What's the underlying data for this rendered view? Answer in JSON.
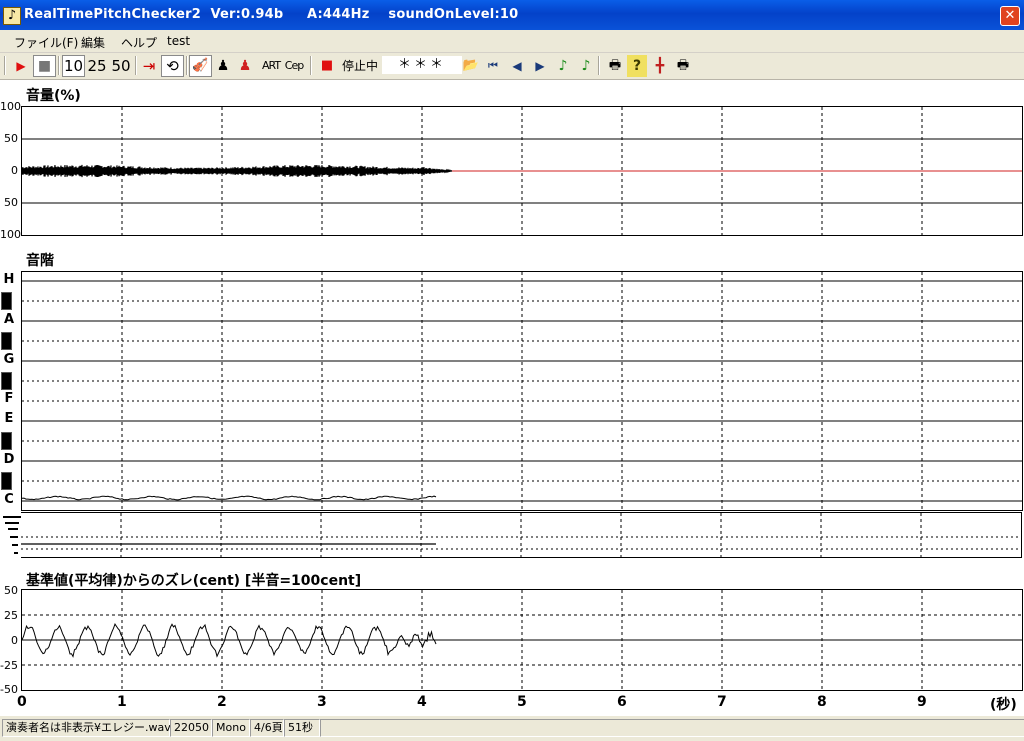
{
  "window": {
    "title": "RealTimePitchChecker2  Ver:0.94b     A:444Hz    soundOnLevel:10",
    "close_glyph": "✕",
    "app_icon_glyph": "♪"
  },
  "menu": [
    "ファイル(F)",
    "編集",
    "ヘルプ",
    "test"
  ],
  "toolbar": {
    "play_glyph": "▶",
    "stop_glyph": "■",
    "speed_10": "10",
    "speed_25": "25",
    "speed_50": "50",
    "goto_end_glyph": "⇥",
    "loop_glyph": "⟲",
    "violin_glyph": "🎻",
    "person_glyph": "♟",
    "person_red_glyph": "♟",
    "art_label": "ART",
    "cep_label": "Cep",
    "rec_glyph": "■",
    "status_label": "停止中",
    "status_value": "＊＊＊",
    "open_glyph": "📂",
    "first_glyph": "⏮",
    "prev_glyph": "◀",
    "next_glyph": "▶",
    "note_green_glyph": "♪",
    "note_green2_glyph": "♪",
    "print_glyph": "🖶",
    "help_glyph": "?",
    "grid_glyph": "╋",
    "print2_glyph": "🖶",
    "accent": "#e01010"
  },
  "volume_panel": {
    "title": "音量(%)",
    "y_ticks": [
      "100",
      "50",
      "0",
      "50",
      "100"
    ]
  },
  "scale_panel": {
    "title": "音階",
    "notes": [
      "H",
      "A",
      "G",
      "F",
      "E",
      "D",
      "C"
    ]
  },
  "cent_panel": {
    "title": "基準値(平均律)からのズレ(cent) [半音=100cent]",
    "y_ticks": [
      "50",
      "25",
      "0",
      "-25",
      "-50"
    ]
  },
  "x_axis": {
    "ticks": [
      "0",
      "1",
      "2",
      "3",
      "4",
      "5",
      "6",
      "7",
      "8",
      "9"
    ],
    "unit": "(秒)"
  },
  "chart_data": {
    "type": "line",
    "x_range": [
      0,
      10
    ],
    "xlabel": "(秒)",
    "series": [
      {
        "name": "音量(%)",
        "ylim": [
          -100,
          100
        ],
        "x": [
          0,
          4.3
        ],
        "envelope": [
          4,
          0
        ]
      },
      {
        "name": "音階",
        "x": [
          0,
          4.15
        ],
        "note": "C"
      },
      {
        "name": "基準値(平均律)からのズレ(cent) [半音=100cent]",
        "ylim": [
          -50,
          50
        ],
        "x": [
          0,
          4.15
        ],
        "y_range_observed": [
          -20,
          20
        ]
      }
    ]
  },
  "statusbar": [
    "演奏者名は非表示¥エレジー.wav",
    "22050",
    "Mono",
    "4/6頁",
    "51秒"
  ]
}
